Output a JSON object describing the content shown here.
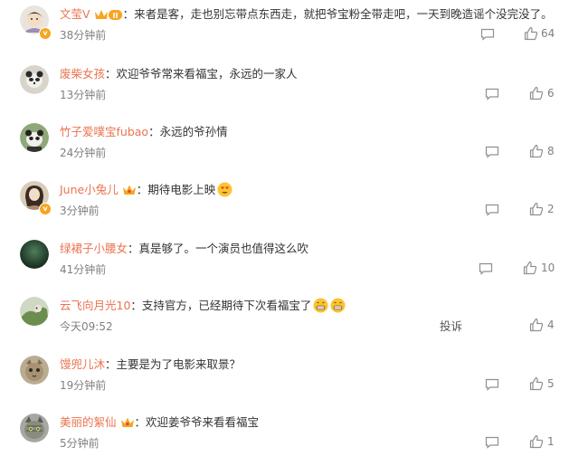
{
  "comments": [
    {
      "user": "文莹V",
      "sep": "：",
      "text": "来者是客，走也别忘带点东西走，就把爷宝粉全带走吧，一天到晚造谣个没完没了。",
      "time": "38分钟前",
      "likes": "64",
      "badge": "crown-level-2",
      "verified": true,
      "verified_mark": "v"
    },
    {
      "user": "废柴女孩",
      "sep": "：",
      "text": "欢迎爷爷常来看福宝，永远的一家人",
      "time": "13分钟前",
      "likes": "6"
    },
    {
      "user": "竹子爱噗宝fubao",
      "sep": "：",
      "text": "永远的爷孙情",
      "time": "24分钟前",
      "likes": "8"
    },
    {
      "user": "June小兔儿",
      "sep": "：",
      "text": "期待电影上映",
      "time": "3分钟前",
      "likes": "2",
      "badge": "crown",
      "verified": true,
      "verified_mark": "v",
      "emojis": [
        "heart-eyes-emoji"
      ]
    },
    {
      "user": "绿裙子小腰女",
      "sep": "：",
      "text": "真是够了。一个演员也值得这么吹",
      "time": "41分钟前",
      "likes": "10"
    },
    {
      "user": "云飞向月光10",
      "sep": "：",
      "text": "支持官方，已经期待下次看福宝了",
      "time": "今天09:52",
      "likes": "4",
      "report": "投诉",
      "emojis": [
        "grin-emoji",
        "grin-emoji"
      ]
    },
    {
      "user": "馒兜儿沐",
      "sep": "：",
      "text": "主要是为了电影来取景？",
      "time": "19分钟前",
      "likes": "5"
    },
    {
      "user": "美丽的絮仙",
      "sep": "：",
      "text": "欢迎姜爷爷来看看福宝",
      "time": "5分钟前",
      "likes": "1",
      "badge": "crown"
    }
  ],
  "colors": {
    "username": "#eb7350",
    "text": "#333333",
    "meta": "#808080",
    "badge_gold": "#f7a51f"
  }
}
